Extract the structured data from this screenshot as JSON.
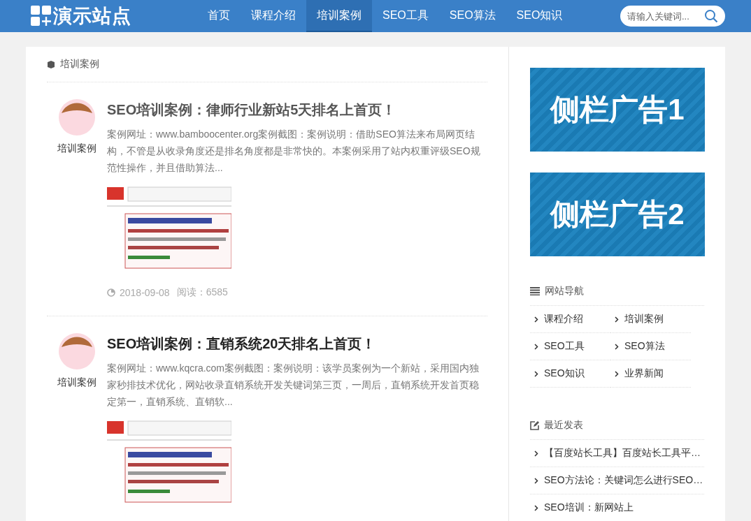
{
  "header": {
    "logo": "演示站点",
    "nav": [
      {
        "label": "首页",
        "selected": false
      },
      {
        "label": "课程介绍",
        "selected": false
      },
      {
        "label": "培训案例",
        "selected": true
      },
      {
        "label": "SEO工具",
        "selected": false
      },
      {
        "label": "SEO算法",
        "selected": false
      },
      {
        "label": "SEO知识",
        "selected": false
      }
    ],
    "search": {
      "placeholder": "请输入关键词..."
    }
  },
  "main": {
    "breadcrumb": "培训案例",
    "articles": [
      {
        "category": "培训案例",
        "title": "SEO培训案例：律师行业新站5天排名上首页！",
        "excerpt": "案例网址：www.bamboocenter.org案例截图：案例说明：借助SEO算法来布局网页结构，不管是从收录角度还是排名角度都是非常快的。本案例采用了站内权重评级SEO规范性操作，并且借助算法...",
        "date": "2018-09-08",
        "views": "阅读：6585"
      },
      {
        "category": "培训案例",
        "title": "SEO培训案例：直销系统20天排名上首页！",
        "excerpt": "案例网址：www.kqcra.com案例截图：案例说明：该学员案例为一个新站，采用国内独家秒排技术优化，网站收录直销系统开发关键词第三页，一周后，直销系统开发首页稳定第一，直销系统、直销软..."
      }
    ]
  },
  "sidebar": {
    "ads": [
      "侧栏广告1",
      "侧栏广告2"
    ],
    "nav_title": "网站导航",
    "nav_items": [
      "课程介绍",
      "培训案例",
      "SEO工具",
      "SEO算法",
      "SEO知识",
      "业界新闻"
    ],
    "recent_title": "最近发表",
    "recent": [
      "【百度站长工具】百度站长工具平…",
      "SEO方法论：关键词怎么进行SEO…",
      "SEO培训：新网站上"
    ]
  }
}
